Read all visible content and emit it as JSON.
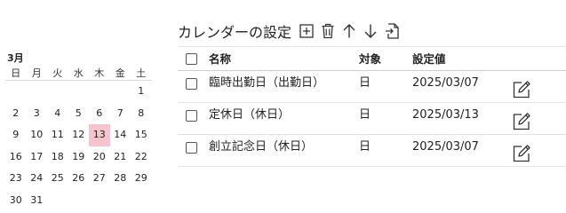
{
  "calendar": {
    "month_label": "3月",
    "weekdays": [
      "日",
      "月",
      "火",
      "水",
      "木",
      "金",
      "土"
    ],
    "weeks": [
      [
        "",
        "",
        "",
        "",
        "",
        "",
        "1"
      ],
      [
        "2",
        "3",
        "4",
        "5",
        "6",
        "7",
        "8"
      ],
      [
        "9",
        "10",
        "11",
        "12",
        "13",
        "14",
        "15"
      ],
      [
        "16",
        "17",
        "18",
        "19",
        "20",
        "21",
        "22"
      ],
      [
        "23",
        "24",
        "25",
        "26",
        "27",
        "28",
        "29"
      ],
      [
        "30",
        "31",
        "",
        "",
        "",
        "",
        ""
      ]
    ],
    "today": "13",
    "today_color": "#f5c4cf"
  },
  "settings": {
    "title": "カレンダーの設定",
    "toolbar_icons": [
      "add-box-icon",
      "trash-icon",
      "arrow-up-icon",
      "arrow-down-icon",
      "export-file-icon"
    ],
    "columns": {
      "name": "名称",
      "target": "対象",
      "value": "設定値"
    },
    "rows": [
      {
        "name": "臨時出勤日（出勤日）",
        "target": "日",
        "value": "2025/03/07"
      },
      {
        "name": "定休日（休日）",
        "target": "日",
        "value": "2025/03/13"
      },
      {
        "name": "創立記念日（休日）",
        "target": "日",
        "value": "2025/03/07"
      }
    ],
    "row_action_icon": "edit-icon"
  }
}
